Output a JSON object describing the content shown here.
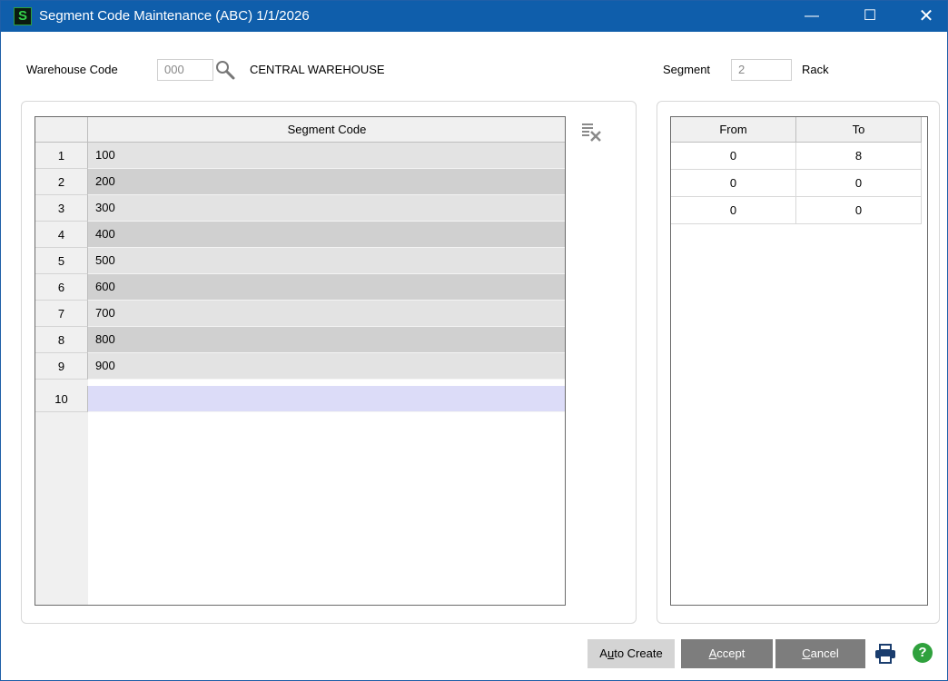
{
  "window": {
    "app_icon_letter": "S",
    "title": "Segment Code Maintenance (ABC) 1/1/2026",
    "minimize": "—",
    "maximize": "☐",
    "close": "✕"
  },
  "header": {
    "warehouse_label": "Warehouse Code",
    "warehouse_value": "000",
    "warehouse_name": "CENTRAL WAREHOUSE",
    "segment_label": "Segment",
    "segment_value": "2",
    "segment_name": "Rack"
  },
  "segment_grid": {
    "column_header": "Segment Code",
    "rows": [
      {
        "num": "1",
        "code": "100"
      },
      {
        "num": "2",
        "code": "200"
      },
      {
        "num": "3",
        "code": "300"
      },
      {
        "num": "4",
        "code": "400"
      },
      {
        "num": "5",
        "code": "500"
      },
      {
        "num": "6",
        "code": "600"
      },
      {
        "num": "7",
        "code": "700"
      },
      {
        "num": "8",
        "code": "800"
      },
      {
        "num": "9",
        "code": "900"
      },
      {
        "num": "10",
        "code": ""
      }
    ]
  },
  "range_grid": {
    "from_header": "From",
    "to_header": "To",
    "rows": [
      {
        "from": "0",
        "to": "8"
      },
      {
        "from": "0",
        "to": "0"
      },
      {
        "from": "0",
        "to": "0"
      }
    ]
  },
  "buttons": {
    "auto_create_pre": "A",
    "auto_create_u": "u",
    "auto_create_post": "to Create",
    "accept_u": "A",
    "accept_post": "ccept",
    "cancel_u": "C",
    "cancel_post": "ancel"
  },
  "icons": {
    "lookup": "magnifier-icon",
    "clear": "delete-row-icon",
    "print": "printer-icon",
    "help": "help-icon"
  },
  "help_glyph": "?",
  "colors": {
    "titlebar": "#0f5eab",
    "row_odd": "#e3e3e3",
    "row_even": "#d0d0d0",
    "active_row": "#dcdcf8",
    "button_dark": "#7d7d7d",
    "help_green": "#2fa13d"
  }
}
